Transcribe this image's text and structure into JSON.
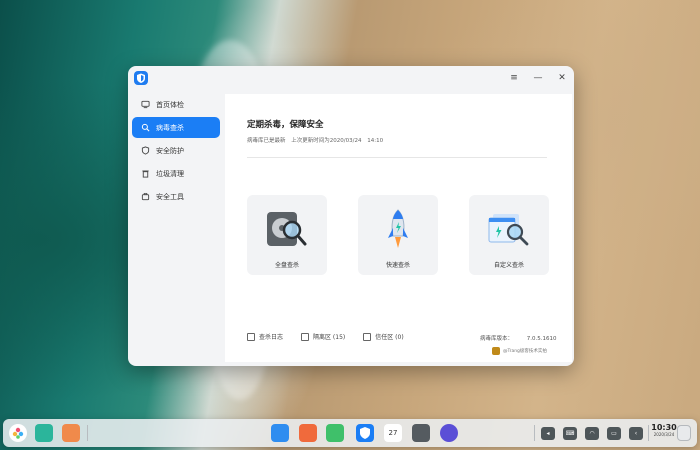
{
  "window": {
    "title_icon": "shield-icon",
    "buttons": {
      "menu": "≡",
      "minimize": "—",
      "close": "✕"
    }
  },
  "sidebar": {
    "items": [
      {
        "label": "首页体检",
        "icon": "monitor-icon",
        "active": false
      },
      {
        "label": "病毒查杀",
        "icon": "scan-icon",
        "active": true
      },
      {
        "label": "安全防护",
        "icon": "shield-lock-icon",
        "active": false
      },
      {
        "label": "垃圾清理",
        "icon": "trash-icon",
        "active": false
      },
      {
        "label": "安全工具",
        "icon": "tools-icon",
        "active": false
      }
    ]
  },
  "main": {
    "title": "定期杀毒，保障安全",
    "status_text": "病毒库已是最新",
    "last_update_label": "上次更新时间为2020/03/24",
    "last_update_time": "14:10",
    "cards": [
      {
        "label": "全盘查杀",
        "icon": "disk-magnifier-icon"
      },
      {
        "label": "快速查杀",
        "icon": "rocket-icon"
      },
      {
        "label": "自定义查杀",
        "icon": "custom-scan-icon"
      }
    ],
    "bottom_links": [
      {
        "label": "查杀日志"
      },
      {
        "label": "隔离区 (15)"
      },
      {
        "label": "信任区 (0)"
      }
    ],
    "version_label": "病毒库版本：",
    "version_value": "7.0.5.1610",
    "watermark": "@Trang极客技术实拍"
  },
  "dock": {
    "clock_time": "10:30",
    "clock_date": "2020/3/24",
    "calendar_day": "27"
  },
  "colors": {
    "accent": "#1b7ef5"
  }
}
